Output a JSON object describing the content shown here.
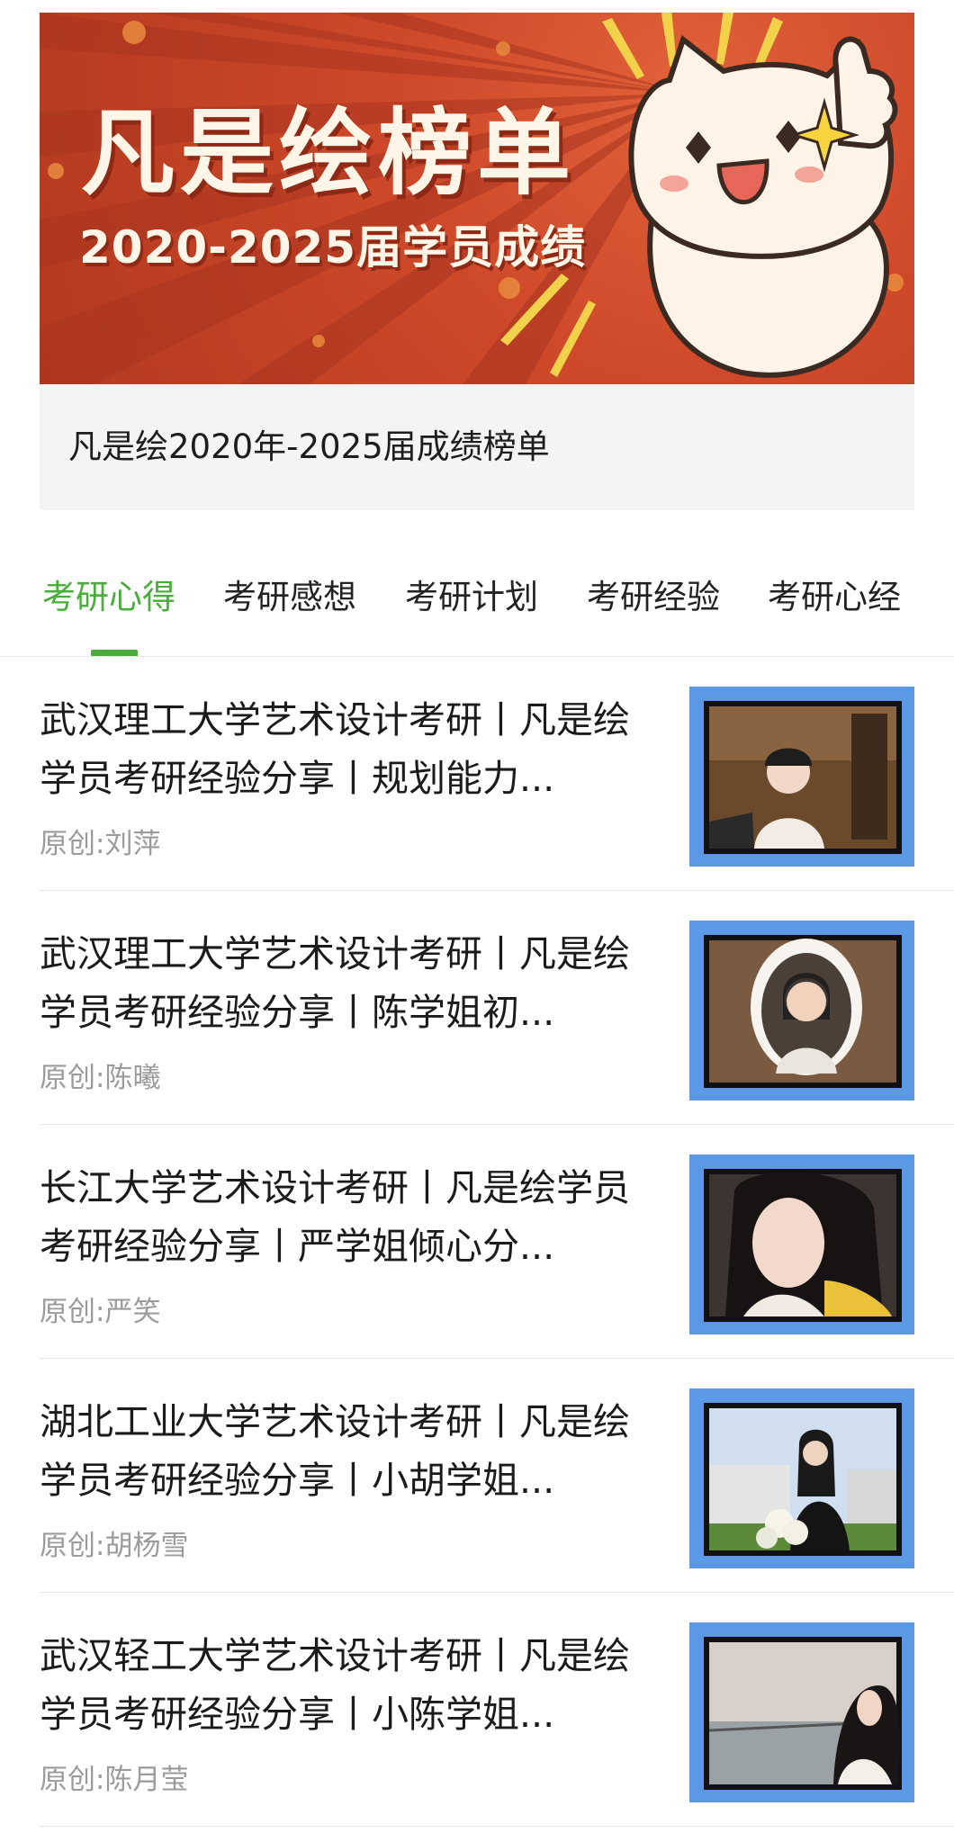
{
  "banner": {
    "title": "凡是绘榜单",
    "subtitle": "2020-2025届学员成绩"
  },
  "caption": "凡是绘2020年-2025届成绩榜单",
  "tabs": [
    {
      "label": "考研心得",
      "active": true
    },
    {
      "label": "考研感想",
      "active": false
    },
    {
      "label": "考研计划",
      "active": false
    },
    {
      "label": "考研经验",
      "active": false
    },
    {
      "label": "考研心经",
      "active": false
    }
  ],
  "articles": [
    {
      "title": "武汉理工大学艺术设计考研丨凡是绘学员考研经验分享丨规划能力...",
      "author": "原创:刘萍"
    },
    {
      "title": "武汉理工大学艺术设计考研丨凡是绘学员考研经验分享丨陈学姐初...",
      "author": "原创:陈曦"
    },
    {
      "title": "长江大学艺术设计考研丨凡是绘学员考研经验分享丨严学姐倾心分...",
      "author": "原创:严笑"
    },
    {
      "title": "湖北工业大学艺术设计考研丨凡是绘学员考研经验分享丨小胡学姐...",
      "author": "原创:胡杨雪"
    },
    {
      "title": "武汉轻工大学艺术设计考研丨凡是绘学员考研经验分享丨小陈学姐...",
      "author": "原创:陈月莹"
    }
  ],
  "colors": {
    "accent_green": "#48ad3a",
    "banner_red": "#c0412a",
    "thumb_border_blue": "#5b98e6"
  }
}
